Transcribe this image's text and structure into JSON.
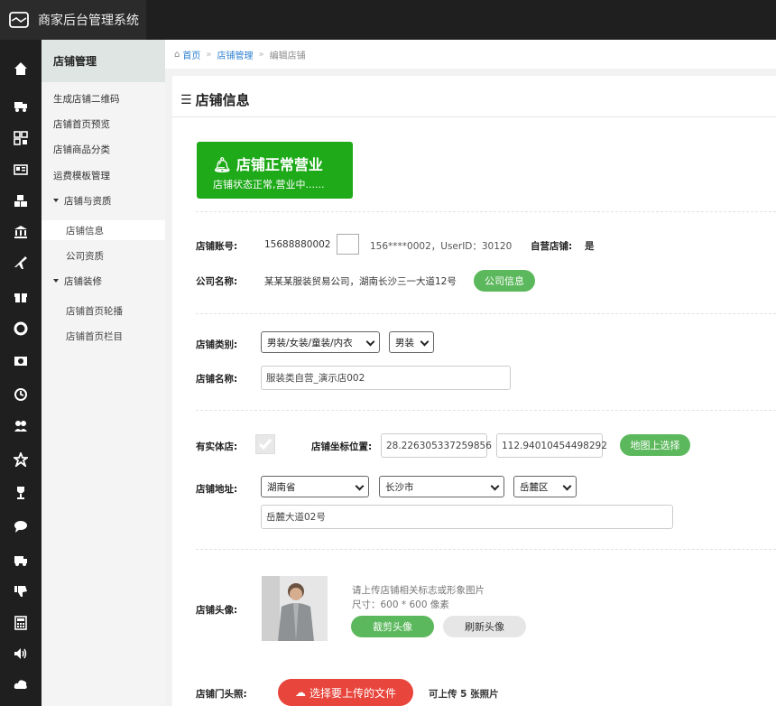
{
  "app": {
    "title": "商家后台管理系统"
  },
  "sidebar_icons": [
    "home-icon",
    "truck-icon",
    "qrcode-icon",
    "newspaper-icon",
    "cubes-icon",
    "bank-icon",
    "plane-icon",
    "gift-icon",
    "lifebuoy-icon",
    "money-icon",
    "clock-icon",
    "users-icon",
    "star-half-icon",
    "trophy-icon",
    "comment-icon",
    "shipping-icon",
    "thumbs-down-icon",
    "calculator-icon",
    "volume-icon",
    "cloud-icon"
  ],
  "menu": {
    "head": "店铺管理",
    "items": [
      "生成店铺二维码",
      "店铺首页预览",
      "店铺商品分类",
      "运费模板管理"
    ],
    "group1": "店铺与资质",
    "group1_items": [
      "店铺信息",
      "公司资质"
    ],
    "group2": "店铺装修",
    "group2_items": [
      "店铺首页轮播",
      "店铺首页栏目"
    ]
  },
  "breadcrumb": {
    "home": "首页",
    "shop": "店铺管理",
    "current": "编辑店铺",
    "sep": "»"
  },
  "panel": {
    "title": "店铺信息"
  },
  "status": {
    "title": "店铺正常营业",
    "desc": "店铺状态正常,营业中......"
  },
  "account": {
    "label": "店铺账号:",
    "number": "15688880002",
    "info": "156****0002，UserID：30120",
    "self_label": "自营店铺:",
    "self_value": "是"
  },
  "company": {
    "label": "公司名称:",
    "value": "某某某服装贸易公司，湖南长沙三一大道12号",
    "button": "公司信息"
  },
  "category": {
    "label": "店铺类别:",
    "select1": "男装/女装/童装/内衣",
    "select2": "男装"
  },
  "shopname": {
    "label": "店铺名称:",
    "value": "服装类自营_演示店002"
  },
  "physical": {
    "label": "有实体店:",
    "coord_label": "店铺坐标位置:",
    "lat": "28.226305337259856",
    "lng": "112.94010454498292",
    "map_button": "地图上选择"
  },
  "address": {
    "label": "店铺地址:",
    "province": "湖南省",
    "city": "长沙市",
    "district": "岳麓区",
    "street": "岳麓大道02号"
  },
  "avatar": {
    "label": "店铺头像:",
    "hint1": "请上传店铺相关标志或形象图片",
    "hint2": "尺寸：600 * 600 像素",
    "crop_button": "裁剪头像",
    "refresh_button": "刷新头像"
  },
  "photos": {
    "label": "店铺门头照:",
    "upload_button": "选择要上传的文件",
    "hint": "可上传 5 张照片"
  },
  "colors": {
    "green": "#1faa1a",
    "pill_green": "#5cb85c",
    "red": "#e8453c",
    "link": "#2a7fd0",
    "dark": "#1f1f1f"
  }
}
